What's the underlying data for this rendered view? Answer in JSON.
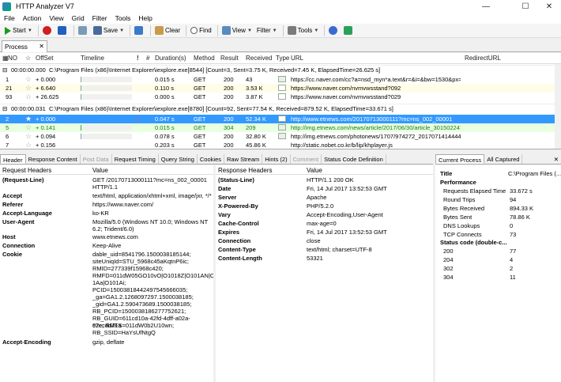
{
  "window": {
    "title": "HTTP Analyzer V7"
  },
  "menu": [
    "File",
    "Action",
    "View",
    "Grid",
    "Filter",
    "Tools",
    "Help"
  ],
  "toolbar": {
    "start": "Start",
    "save": "Save",
    "clear": "Clear",
    "find": "Find",
    "view": "View",
    "filter": "Filter",
    "tools": "Tools"
  },
  "process_tab": {
    "label": "Process"
  },
  "grid": {
    "columns": [
      "NO",
      "OffSet",
      "Timeline",
      "!",
      "#",
      "Duration(s)",
      "Method",
      "Result",
      "Received",
      "Type",
      "URL",
      "RedirectURL"
    ],
    "groups": [
      {
        "header_time": "00:00:00.000",
        "header_text": "C:\\Program Files (x86)\\Internet Explorer\\iexplore.exe[8544]  [Count=3, Sent=3.75 K, Received=7.45 K, ElapsedTime=26.625 s]",
        "rows": [
          {
            "no": "1",
            "offset": "+ 0.000",
            "duration": "0.015 s",
            "method": "GET",
            "result": "200",
            "received": "43",
            "url": "https://cc.naver.com/cc?a=nsd_myn*a.text&r=&i=&bw=1530&px=683..."
          },
          {
            "no": "21",
            "offset": "+ 6.640",
            "duration": "0.110 s",
            "method": "GET",
            "result": "200",
            "received": "3.53 K",
            "url": "https://www.naver.com/nvmvwsstand?092"
          },
          {
            "no": "93",
            "offset": "+ 26.625",
            "duration": "0.000 s",
            "method": "GET",
            "result": "200",
            "received": "3.87 K",
            "url": "https://www.naver.com/nvmvwsstand?029"
          }
        ]
      },
      {
        "header_time": "00:00:00.031",
        "header_text": "C:\\Program Files (x86)\\Internet Explorer\\iexplore.exe[8780]  [Count=92, Sent=77.54 K, Received=879.52 K, ElapsedTime=33.671 s]",
        "rows": [
          {
            "no": "2",
            "offset": "+ 0.000",
            "duration": "0.047 s",
            "method": "GET",
            "result": "200",
            "received": "52.34 K",
            "url": "http://www.etnews.com/20170713000111?mc=ns_002_00001"
          },
          {
            "no": "5",
            "offset": "+ 0.141",
            "duration": "0.015 s",
            "method": "GET",
            "result": "304",
            "received": "209",
            "url": "http://img.etnews.com/news/article/2017/06/30/article_3015022470..."
          },
          {
            "no": "6",
            "offset": "+ 0.094",
            "duration": "0.078 s",
            "method": "GET",
            "result": "200",
            "received": "32.80 K",
            "url": "http://img.etnews.com/photonews/1707/974272_20170714144449_..."
          },
          {
            "no": "7",
            "offset": "+ 0.156",
            "duration": "0.203 s",
            "method": "GET",
            "result": "200",
            "received": "45.86 K",
            "url": "http://static.nobet.co.kr/b/lip/khplayer.js"
          }
        ]
      }
    ]
  },
  "detail_tabs": [
    "Header",
    "Response Content",
    "Post Data",
    "Request Timing",
    "Query String",
    "Cookies",
    "Raw Stream",
    "Hints (2)",
    "Comment",
    "Status Code Definition"
  ],
  "request_headers": {
    "col_key": "Request Headers",
    "col_value": "Value",
    "items": [
      {
        "k": "(Request-Line)",
        "v": [
          "GET /20170713000111?mc=ns_002_00001",
          "HTTP/1.1"
        ]
      },
      {
        "k": "Accept",
        "v": [
          "text/html, application/xhtml+xml, image/jxr, */*"
        ]
      },
      {
        "k": "Referer",
        "v": [
          "https://www.naver.com/"
        ]
      },
      {
        "k": "Accept-Language",
        "v": [
          "ko-KR"
        ]
      },
      {
        "k": "User-Agent",
        "v": [
          "Mozilla/5.0 (Windows NT 10.0; Windows NT",
          "6.2; Trident/6.0)"
        ]
      },
      {
        "k": "Host",
        "v": [
          "www.etnews.com"
        ]
      },
      {
        "k": "Connection",
        "v": [
          "Keep-Alive"
        ]
      },
      {
        "k": "Cookie",
        "v": [
          "dable_uid=8541796.1500038185144;",
          "siteUniqId=STU_5968c45aKqtnP6ic;",
          "RMID=277339f15968c420;",
          "RMFD=011dW05GO10vO|O1018Z|O101AN|O10",
          "1Aa|O101Ai;",
          "PCID=15003818442497545666035;",
          "_ga=GA1.2.1268097297.1500038185;",
          "_gid=GA1.2.590473689.1500038185;",
          "RB_PCID=1500038186277752621;",
          "RB_GUID=611cd10a-42fd-4dff-a02a-c7ecdd71a",
          "92c; RMFS=011dW0b2U10wn;",
          "RB_SSID=HaYsUfNtgQ"
        ]
      },
      {
        "k": "Accept-Encoding",
        "v": [
          "gzip, deflate"
        ]
      }
    ]
  },
  "response_headers": {
    "col_key": "Response Headers",
    "col_value": "Value",
    "items": [
      {
        "k": "(Status-Line)",
        "v": "HTTP/1.1 200 OK"
      },
      {
        "k": "Date",
        "v": "Fri, 14 Jul 2017 13:52:53 GMT"
      },
      {
        "k": "Server",
        "v": "Apache"
      },
      {
        "k": "X-Powered-By",
        "v": "PHP/5.2.0"
      },
      {
        "k": "Vary",
        "v": "Accept-Encoding,User-Agent"
      },
      {
        "k": "Cache-Control",
        "v": "max-age=0"
      },
      {
        "k": "Expires",
        "v": "Fri, 14 Jul 2017 13:52:53 GMT"
      },
      {
        "k": "Connection",
        "v": "close"
      },
      {
        "k": "Content-Type",
        "v": "text/html; charset=UTF-8"
      },
      {
        "k": "Content-Length",
        "v": "53321"
      }
    ]
  },
  "right_tabs": [
    "Current Process",
    "All Captured"
  ],
  "current_process": {
    "title_label": "Title",
    "title_value": "C:\\Program Files (...",
    "performance_label": "Performance",
    "metrics": [
      {
        "k": "Requests Elapsed Time",
        "v": "33.672 s"
      },
      {
        "k": "Round Trips",
        "v": "94"
      },
      {
        "k": "Bytes Received",
        "v": "894.33 K"
      },
      {
        "k": "Bytes Sent",
        "v": "78.86 K"
      },
      {
        "k": "DNS Lookups",
        "v": "0"
      },
      {
        "k": "TCP Connects",
        "v": "73"
      }
    ],
    "status_label": "Status code (double-c...",
    "status_codes": [
      {
        "k": "200",
        "v": "77"
      },
      {
        "k": "204",
        "v": "4"
      },
      {
        "k": "302",
        "v": "2"
      },
      {
        "k": "304",
        "v": "11"
      }
    ]
  }
}
